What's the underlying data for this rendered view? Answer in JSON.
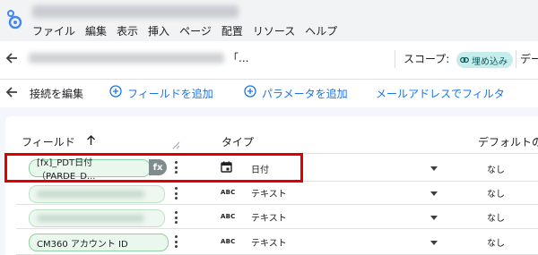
{
  "app": {
    "menu": [
      "ファイル",
      "編集",
      "表示",
      "挿入",
      "ページ",
      "配置",
      "リソース",
      "ヘルプ"
    ]
  },
  "datasource": {
    "title_suffix": "「...",
    "scope_label": "スコープ:",
    "scope_chip": "埋め込み",
    "data_label": "デー"
  },
  "toolbar": {
    "edit_connection": "接続を編集",
    "add_field": "フィールドを追加",
    "add_parameter": "パラメータを追加",
    "filter_by_email": "メールアドレスでフィルタ"
  },
  "table": {
    "headers": {
      "field": "フィールド",
      "type": "タイプ",
      "default": "デフォルトの"
    },
    "rows": [
      {
        "field": "[fx]_PDT日付（PARDE_D...",
        "badge": "fx",
        "type_icon": "calendar-icon",
        "type": "日付",
        "default": "なし"
      },
      {
        "field": "",
        "type_icon": "ABC",
        "type": "テキスト",
        "default": "なし"
      },
      {
        "field": "",
        "type_icon": "ABC",
        "type": "テキスト",
        "default": "なし"
      },
      {
        "field": "CM360 アカウント ID",
        "type_icon": "ABC",
        "type": "テキスト",
        "default": "なし"
      }
    ]
  },
  "colors": {
    "accent": "#1a73e8",
    "highlight": "#e00000",
    "pill_border": "#8fd19e",
    "scope_chip": "#c7ecec"
  }
}
